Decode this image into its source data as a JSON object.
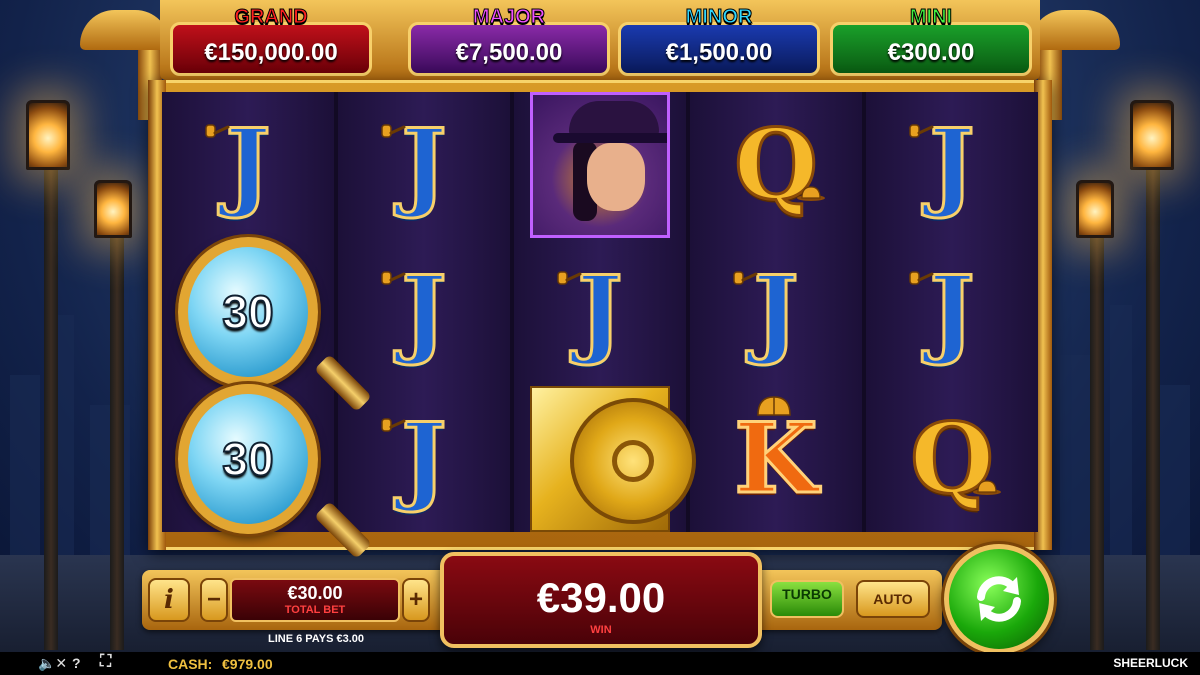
{
  "jackpots": [
    {
      "title": "GRAND",
      "value": "€150,000.00",
      "color": "#c0101a"
    },
    {
      "title": "MAJOR",
      "value": "€7,500.00",
      "color": "#8a2aa8"
    },
    {
      "title": "MINOR",
      "value": "€1,500.00",
      "color": "#1a3ab0"
    },
    {
      "title": "MINI",
      "value": "€300.00",
      "color": "#1aa02a"
    }
  ],
  "reels": [
    [
      {
        "type": "J",
        "icon": "pipe-icon"
      },
      {
        "type": "magnifier",
        "value": "30"
      },
      {
        "type": "magnifier",
        "value": "30"
      }
    ],
    [
      {
        "type": "J",
        "icon": "pipe-icon"
      },
      {
        "type": "J",
        "icon": "pipe-icon"
      },
      {
        "type": "J",
        "icon": "pipe-icon"
      }
    ],
    [
      {
        "type": "detective"
      },
      {
        "type": "J",
        "icon": "pipe-icon"
      },
      {
        "type": "vault"
      }
    ],
    [
      {
        "type": "Q",
        "icon": "bowler-hat-icon"
      },
      {
        "type": "J",
        "icon": "pipe-icon"
      },
      {
        "type": "K",
        "icon": "deerstalker-hat-icon"
      }
    ],
    [
      {
        "type": "J",
        "icon": "pipe-icon"
      },
      {
        "type": "J",
        "icon": "pipe-icon"
      },
      {
        "type": "Q",
        "icon": "bowler-hat-icon"
      }
    ]
  ],
  "controls": {
    "info_label": "i",
    "minus_label": "−",
    "plus_label": "+",
    "total_bet_value": "€30.00",
    "total_bet_label": "TOTAL BET",
    "win_value": "€39.00",
    "win_label": "WIN",
    "turbo_label": "TURBO",
    "auto_label": "AUTO",
    "line_pays": "LINE 6 PAYS €3.00"
  },
  "bottom_bar": {
    "sound_icon": "🔈✕",
    "help_icon": "?",
    "fullscreen_icon": "⛶",
    "cash_label": "CASH:",
    "cash_value": "€979.00",
    "brand": "SHEERLUCK"
  }
}
